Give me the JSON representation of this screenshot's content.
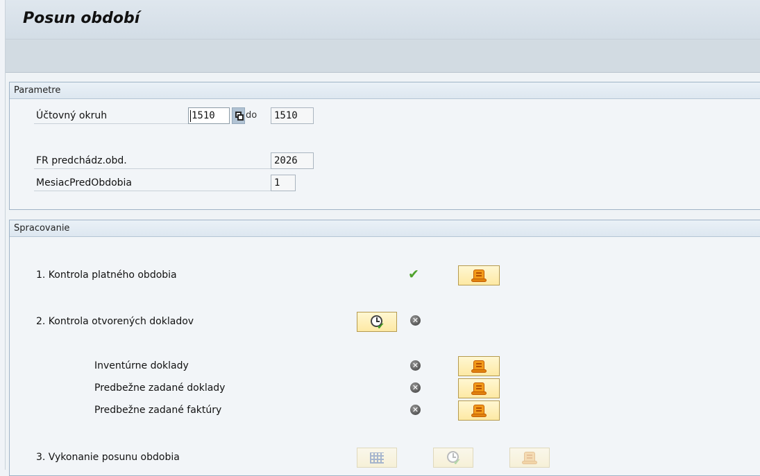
{
  "title": "Posun období",
  "parametre": {
    "header": "Parametre",
    "ucet_label": "Účtovný okruh",
    "ucet_from": "1510",
    "to_label": "do",
    "ucet_to": "1510",
    "fr_label": "FR predchádz.obd.",
    "fr_value": "2026",
    "mesiac_label": "MesiacPredObdobia",
    "mesiac_value": "1"
  },
  "spracovanie": {
    "header": "Spracovanie",
    "step1": {
      "label": "1. Kontrola platného obdobia",
      "status": "success"
    },
    "step2": {
      "label": "2. Kontrola otvorených dokladov",
      "status": "not-run"
    },
    "sub_items": [
      {
        "label": "Inventúrne doklady",
        "status": "not-run"
      },
      {
        "label": "Predbežne zadané doklady",
        "status": "not-run"
      },
      {
        "label": "Predbežne zadané faktúry",
        "status": "not-run"
      }
    ],
    "step3": {
      "label": "3. Vykonanie posunu obdobia"
    }
  },
  "icons": {
    "execute": "clock-check-icon",
    "log": "scroll-log-icon",
    "check": "green-check-icon",
    "not_run": "grey-x-icon",
    "grid": "grid-icon"
  },
  "colors": {
    "title_bg": "#d3dde6",
    "group_border": "#9fb3c6",
    "button_bg": "#fde9a4",
    "success": "#4fa22c",
    "neutral": "#555555"
  }
}
